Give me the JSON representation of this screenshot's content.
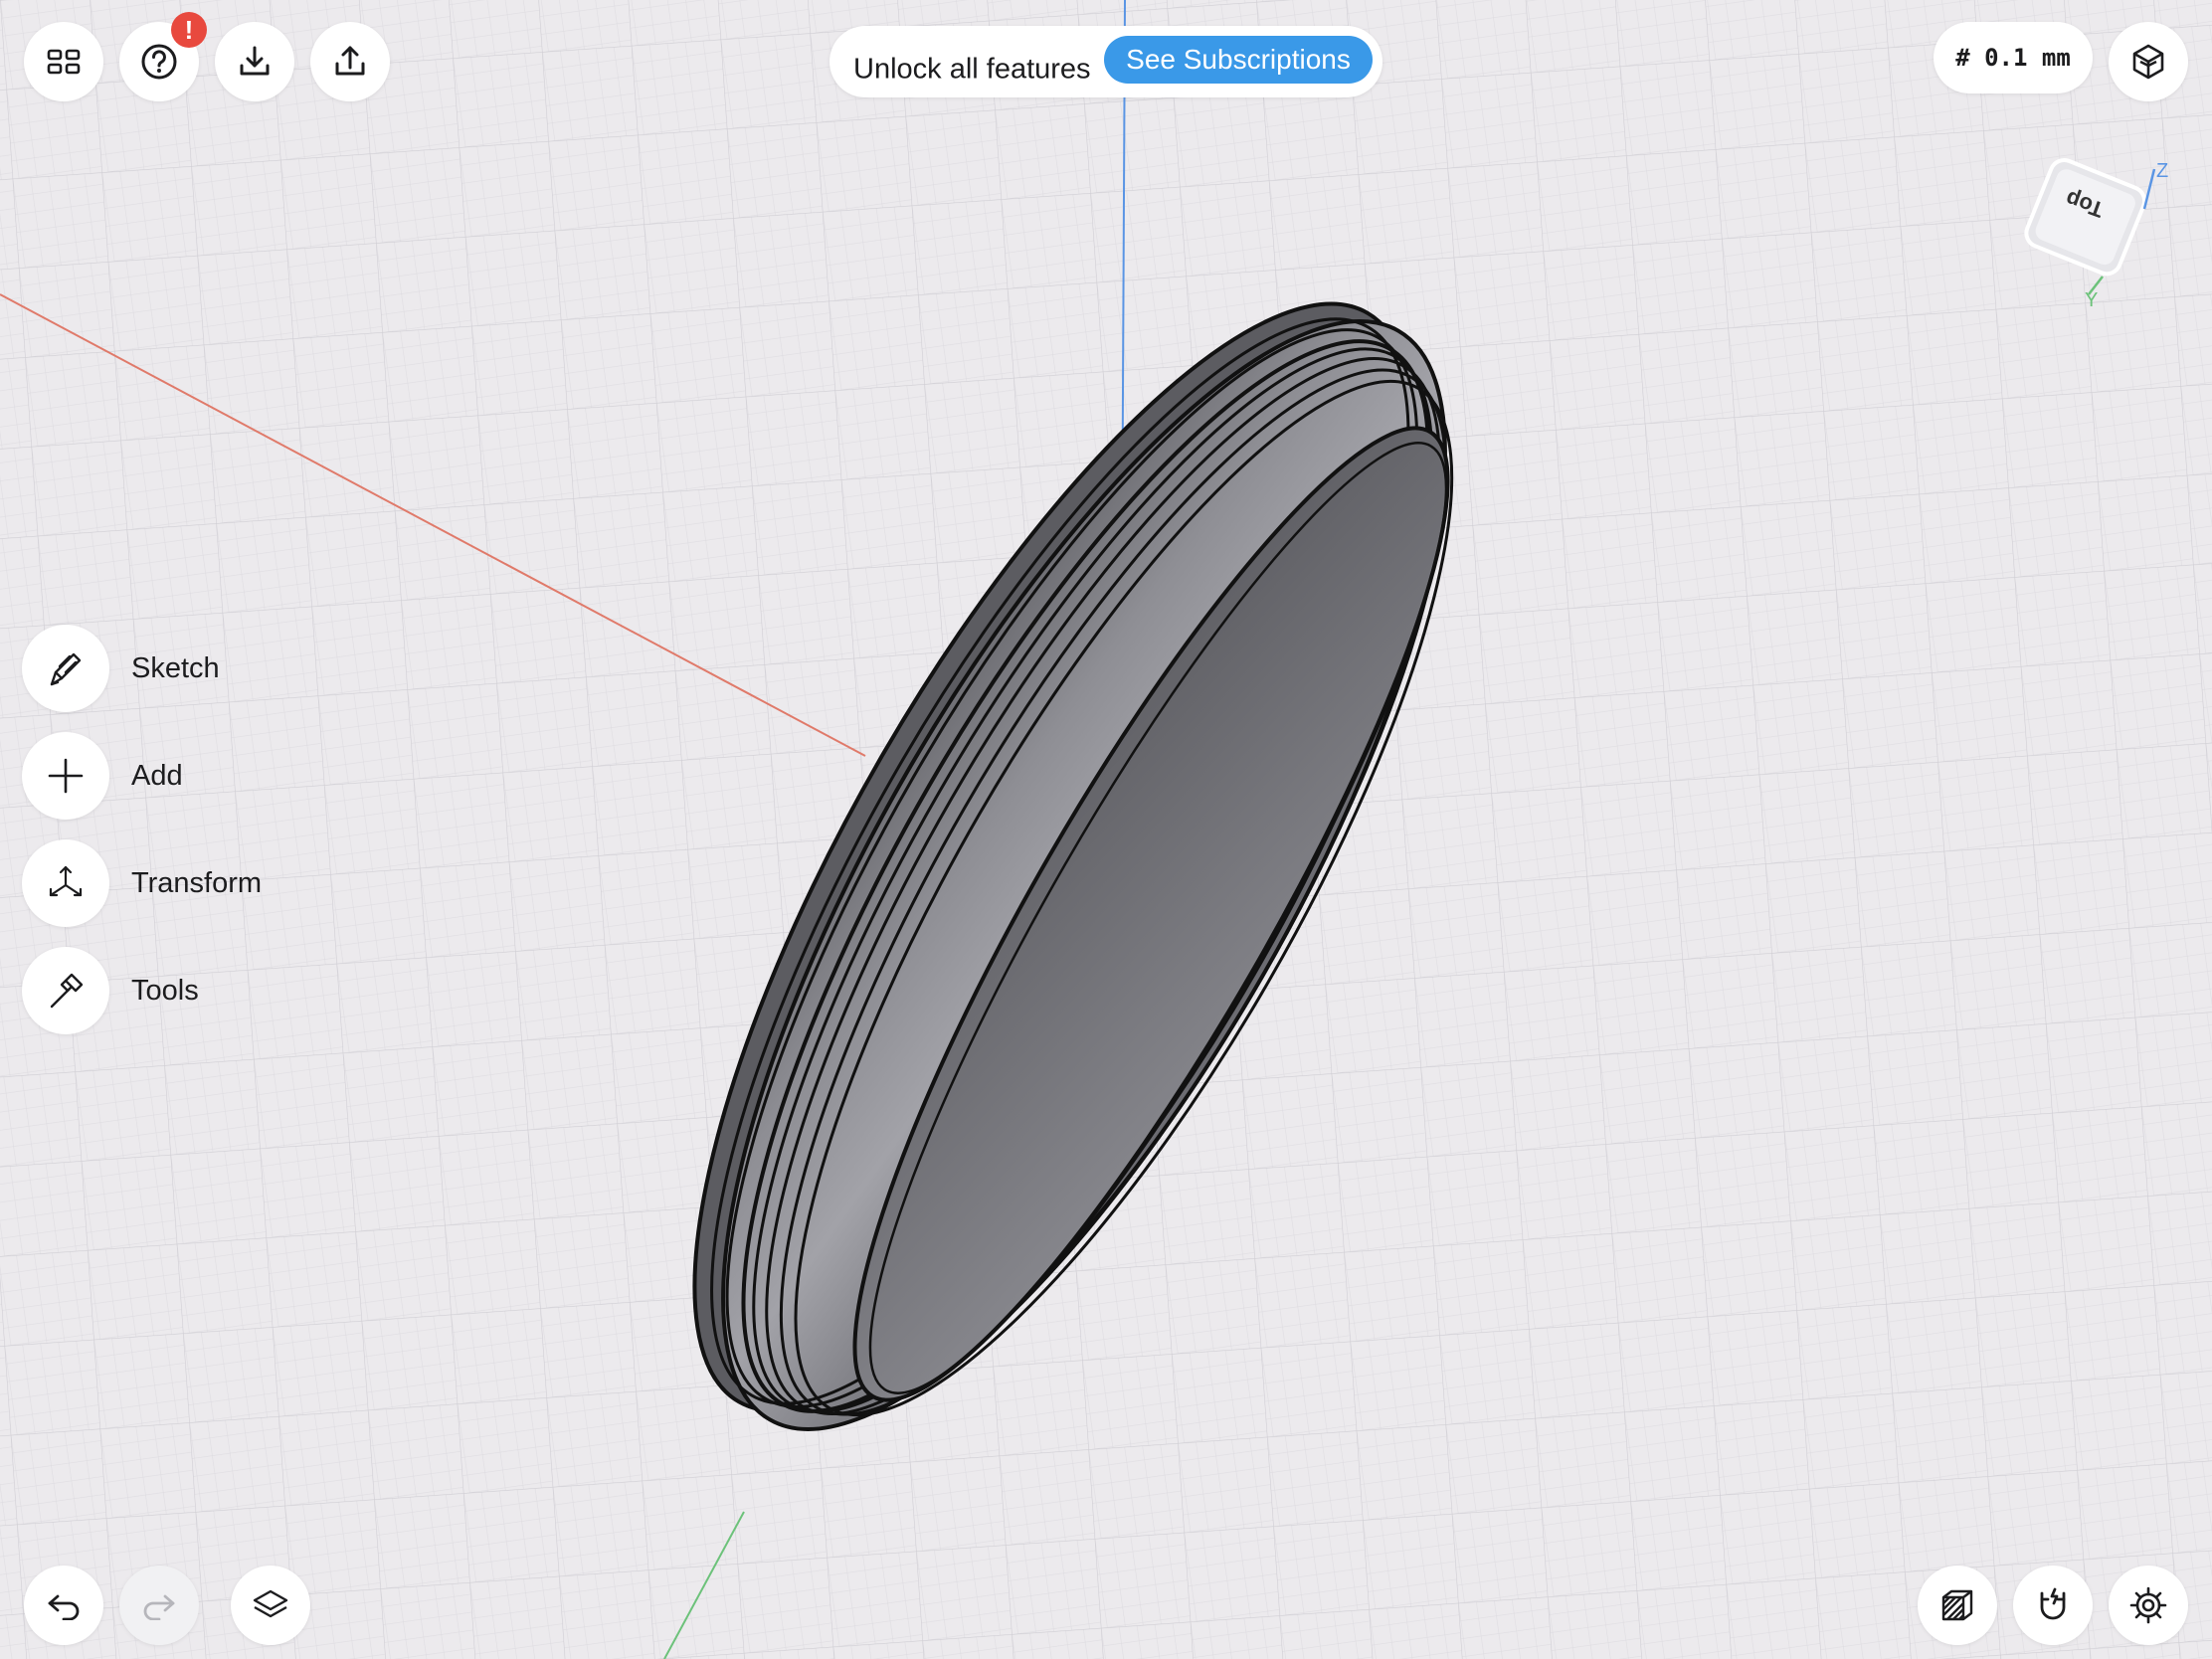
{
  "toolbar": {
    "help_badge": "!"
  },
  "promo": {
    "text": "Unlock all features",
    "button_label": "See Subscriptions"
  },
  "grid_unit": "# 0.1 mm",
  "view_cube": {
    "face_label": "Top",
    "axis_z": "Z",
    "axis_y": "Y"
  },
  "tools": [
    {
      "label": "Sketch",
      "icon": "pencil-icon"
    },
    {
      "label": "Add",
      "icon": "plus-icon"
    },
    {
      "label": "Transform",
      "icon": "transform-arrows-icon"
    },
    {
      "label": "Tools",
      "icon": "hammer-icon"
    }
  ],
  "colors": {
    "accent": "#3a99e8",
    "badge": "#e8493e",
    "x_axis": "#e07a6a",
    "y_axis": "#6cc27a",
    "z_axis": "#5a95e4",
    "model": "#8b8b90",
    "background": "#eceaed"
  }
}
